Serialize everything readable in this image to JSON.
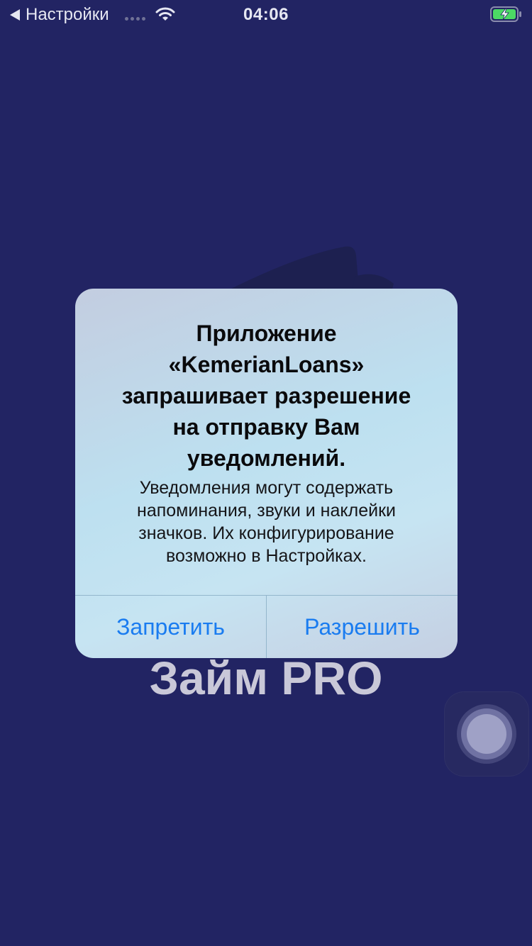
{
  "status_bar": {
    "back_label": "Настройки",
    "time": "04:06",
    "icons": [
      "back-arrow-icon",
      "signal-dots-icon",
      "wifi-icon",
      "battery-charging-icon"
    ]
  },
  "background": {
    "app_title": "Займ PRO",
    "colors": {
      "background": "#222463",
      "title": "#c9c8d8"
    }
  },
  "alert": {
    "title_lines": [
      "Приложение",
      "«KemerianLoans»",
      "запрашивает разрешение",
      "на отправку Вам",
      "уведомлений."
    ],
    "message_lines": [
      "Уведомления могут содержать",
      "напоминания, звуки и наклейки",
      "значков. Их конфигурирование",
      "возможно в Настройках."
    ],
    "deny_label": "Запретить",
    "allow_label": "Разрешить",
    "colors": {
      "button_text": "#1a7cf0"
    }
  }
}
